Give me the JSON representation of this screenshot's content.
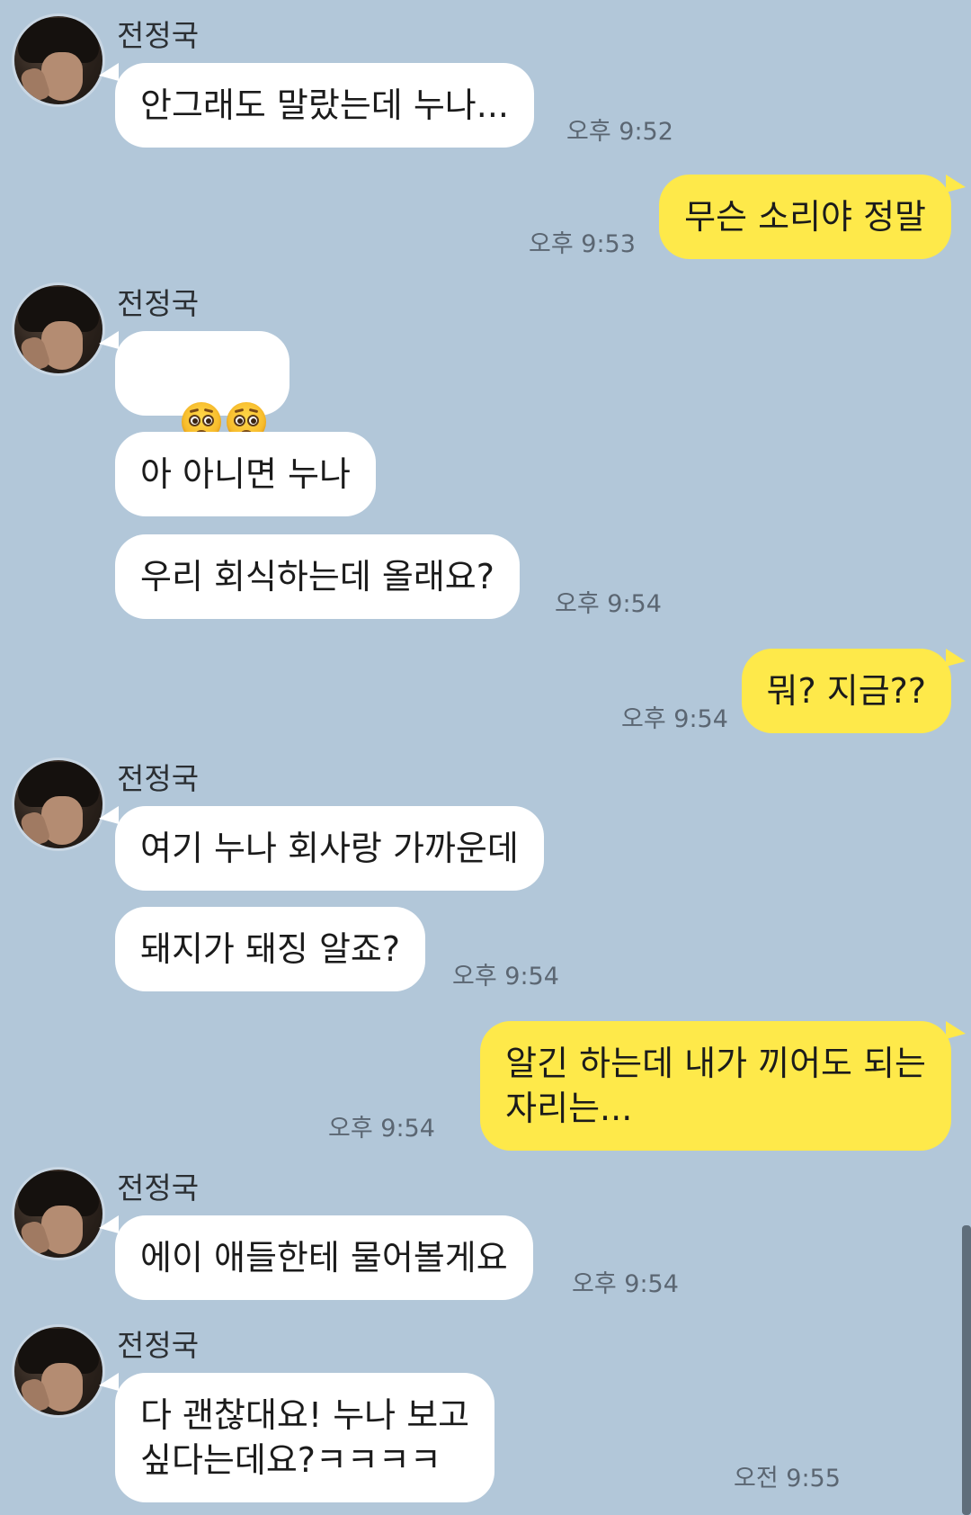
{
  "contact": {
    "name": "전정국"
  },
  "colors": {
    "background": "#b2c7d9",
    "incoming_bubble": "#ffffff",
    "outgoing_bubble": "#fee94a"
  },
  "messages": [
    {
      "from": "in",
      "text": "안그래도 말랐는데 누나...",
      "time": "오후 9:52"
    },
    {
      "from": "out",
      "text": "무슨 소리야 정말",
      "time": "오후 9:53"
    },
    {
      "from": "in",
      "emoji": [
        "pleading-face-icon",
        "pleading-face-icon"
      ]
    },
    {
      "from": "in",
      "text": "아 아니면 누나"
    },
    {
      "from": "in",
      "text": "우리 회식하는데 올래요?",
      "time": "오후 9:54"
    },
    {
      "from": "out",
      "text": "뭐? 지금??",
      "time": "오후 9:54"
    },
    {
      "from": "in",
      "text": "여기 누나 회사랑 가까운데"
    },
    {
      "from": "in",
      "text": "돼지가 돼징 알죠?",
      "time": "오후 9:54"
    },
    {
      "from": "out",
      "text": "알긴 하는데 내가 끼어도 되는\n자리는...",
      "time": "오후 9:54"
    },
    {
      "from": "in",
      "text": "에이 애들한테 물어볼게요",
      "time": "오후 9:54"
    },
    {
      "from": "in",
      "text": "다 괜찮대요! 누나 보고\n싶다는데요?ㅋㅋㅋㅋ",
      "time": "오전 9:55"
    }
  ]
}
